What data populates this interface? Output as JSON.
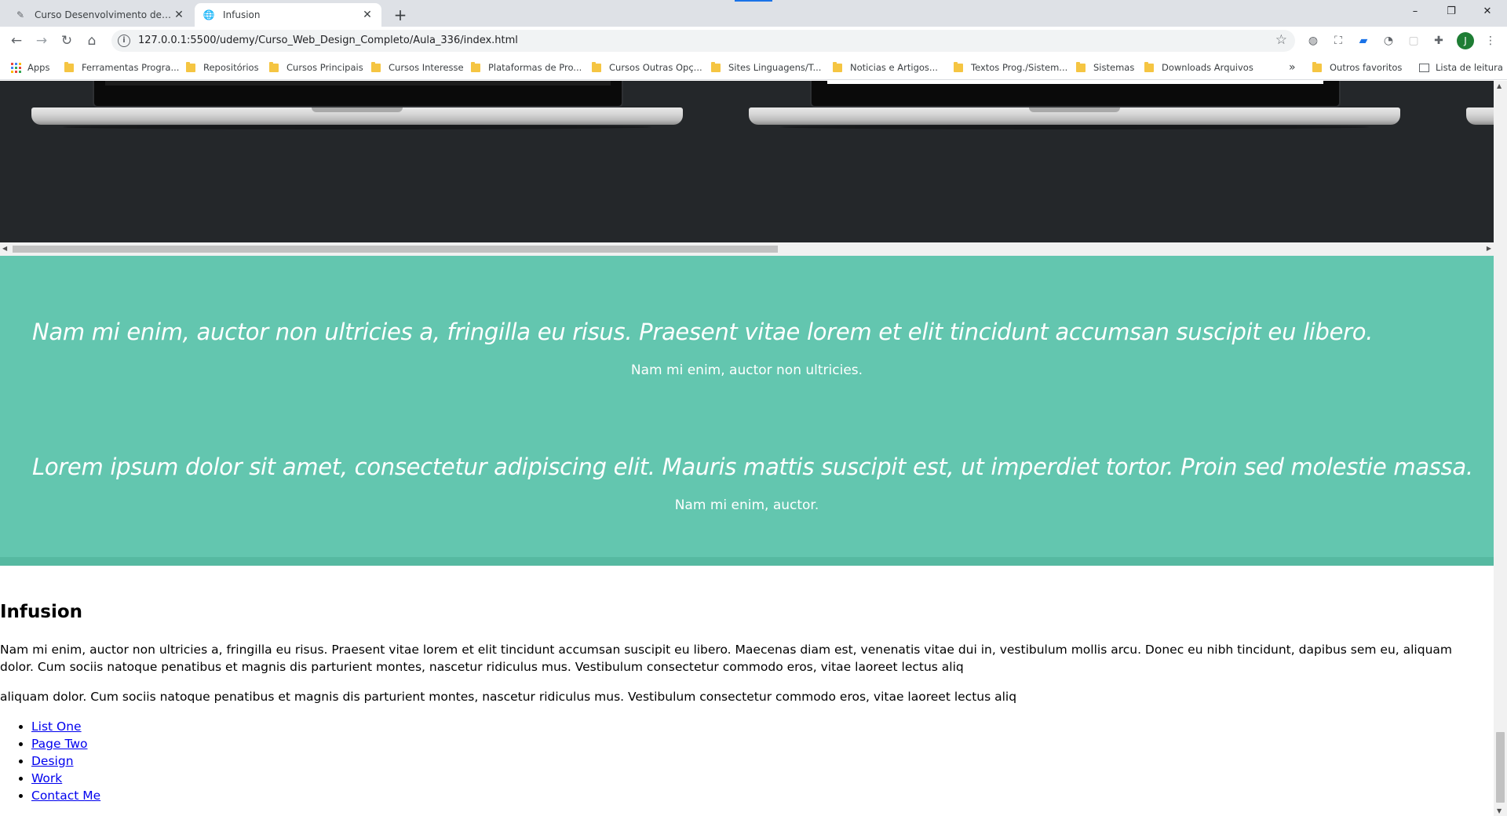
{
  "browser": {
    "tabs": [
      {
        "title": "Curso Desenvolvimento de layout",
        "active": false
      },
      {
        "title": "Infusion",
        "active": true
      }
    ],
    "url": "127.0.0.1:5500/udemy/Curso_Web_Design_Completo/Aula_336/index.html",
    "profile_initial": "J",
    "window_controls": {
      "minimize": "–",
      "maximize": "❐",
      "close": "✕"
    },
    "bookmarks": [
      {
        "label": "Apps",
        "icon": "apps-icon"
      },
      {
        "label": "Ferramentas Progra...",
        "icon": "folder-icon"
      },
      {
        "label": "Repositórios",
        "icon": "folder-icon"
      },
      {
        "label": "Cursos Principais",
        "icon": "folder-icon"
      },
      {
        "label": "Cursos Interesse",
        "icon": "folder-icon"
      },
      {
        "label": "Plataformas de Pro...",
        "icon": "folder-icon"
      },
      {
        "label": "Cursos Outras Opç...",
        "icon": "folder-icon"
      },
      {
        "label": "Sites Linguagens/T...",
        "icon": "folder-icon"
      },
      {
        "label": "Noticias e Artigos...",
        "icon": "folder-icon"
      },
      {
        "label": "Textos Prog./Sistem...",
        "icon": "folder-icon"
      },
      {
        "label": "Sistemas",
        "icon": "folder-icon"
      },
      {
        "label": "Downloads Arquivos",
        "icon": "folder-icon"
      },
      {
        "label": "»",
        "icon": "overflow-chevron-icon"
      },
      {
        "label": "Outros favoritos",
        "icon": "folder-icon"
      },
      {
        "label": "Lista de leitura",
        "icon": "reading-list-icon"
      }
    ]
  },
  "page": {
    "testimonials": [
      {
        "quote": "Nam mi enim, auctor non ultricies a, fringilla eu risus. Praesent vitae lorem et elit tincidunt accumsan suscipit eu libero.",
        "cite": "Nam mi enim, auctor non ultricies."
      },
      {
        "quote": "Lorem ipsum dolor sit amet, consectetur adipiscing elit. Mauris mattis suscipit est, ut imperdiet tortor. Proin sed molestie massa.",
        "cite": "Nam mi enim, auctor."
      }
    ],
    "about": {
      "heading": "Infusion",
      "paragraph1": "Nam mi enim, auctor non ultricies a, fringilla eu risus. Praesent vitae lorem et elit tincidunt accumsan suscipit eu libero. Maecenas diam est, venenatis vitae dui in, vestibulum mollis arcu. Donec eu nibh tincidunt, dapibus sem eu, aliquam dolor. Cum sociis natoque penatibus et magnis dis parturient montes, nascetur ridiculus mus. Vestibulum consectetur commodo eros, vitae laoreet lectus aliq",
      "paragraph2": "aliquam dolor. Cum sociis natoque penatibus et magnis dis parturient montes, nascetur ridiculus mus. Vestibulum consectetur commodo eros, vitae laoreet lectus aliq"
    },
    "nav_links": [
      "List One",
      "Page Two",
      "Design",
      "Work",
      "Contact Me"
    ],
    "colors": {
      "testimonial_bg": "#63c6af",
      "dark_strip": "#24272a",
      "link": "#0000ee"
    }
  }
}
